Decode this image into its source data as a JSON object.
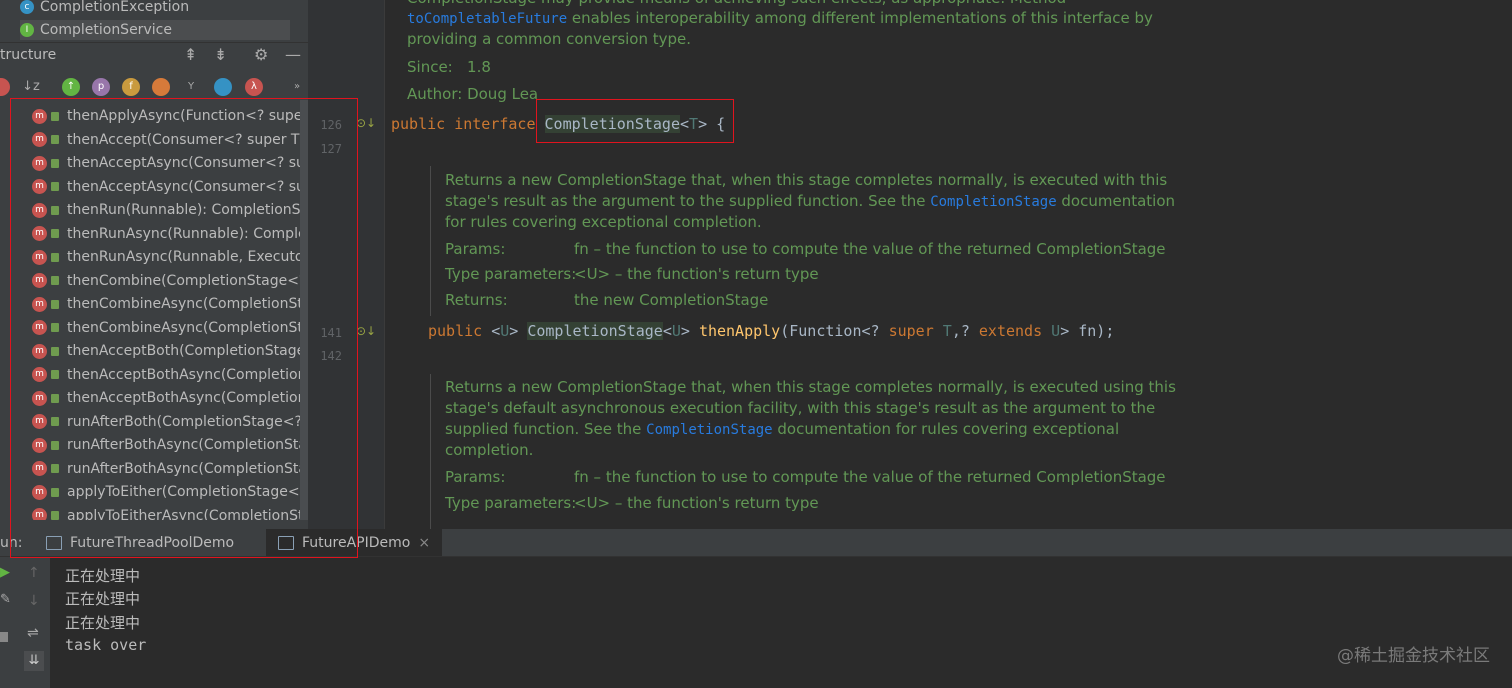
{
  "project_tree": [
    {
      "label": "CompletionException",
      "icon": "class-icon",
      "color": "#3592c4"
    },
    {
      "label": "CompletionService",
      "icon": "interface-icon",
      "color": "#62b543"
    }
  ],
  "structure": {
    "title": "tructure",
    "methods": [
      "thenApplyAsync(Function<? super",
      "thenAccept(Consumer<? super T>",
      "thenAcceptAsync(Consumer<? su",
      "thenAcceptAsync(Consumer<? su",
      "thenRun(Runnable): CompletionSt",
      "thenRunAsync(Runnable): Comple",
      "thenRunAsync(Runnable, Executor",
      "thenCombine(CompletionStage<?",
      "thenCombineAsync(CompletionSt",
      "thenCombineAsync(CompletionSt",
      "thenAcceptBoth(CompletionStage",
      "thenAcceptBothAsync(Completion",
      "thenAcceptBothAsync(Completion",
      "runAfterBoth(CompletionStage<?:",
      "runAfterBothAsync(CompletionSta",
      "runAfterBothAsync(CompletionSta",
      "applyToEither(CompletionStage<?",
      "applyToEitherAsync(CompletionSt"
    ]
  },
  "gutter": {
    "lines": [
      "126",
      "127",
      "141",
      "142"
    ]
  },
  "editor": {
    "doc_top_line0": "CompletionStage may provide means of achieving such effects, as appropriate. Method",
    "doc_top_link": "toCompletableFuture",
    "doc_top_line1_rest": " enables interoperability among different implementations of this interface by",
    "doc_top_line2": "providing a common conversion type.",
    "since_label": "Since:",
    "since_value": "1.8",
    "author_label": "Author:",
    "author_value": "Doug Lea",
    "decl": {
      "kw1": "public",
      "kw2": "interface",
      "type": "CompletionStage",
      "lt": "<",
      "tvar": "T",
      "gt": ">",
      "brace": "{"
    },
    "doc1": {
      "line1": "Returns a new CompletionStage that, when this stage completes normally, is executed with this",
      "line2_pre": "stage's result as the argument to the supplied function. See the ",
      "line2_link": "CompletionStage",
      "line2_post": " documentation",
      "line3": "for rules covering exceptional completion.",
      "params_label": "Params:",
      "params_value": "fn – the function to use to compute the value of the returned CompletionStage",
      "typeparams_label": "Type parameters:",
      "typeparams_value": "<U> – the function's return type",
      "returns_label": "Returns:",
      "returns_value": "the new CompletionStage"
    },
    "method1": {
      "kw1": "public",
      "tp1": "<",
      "tv1": "U",
      "tp2": ">",
      "type": "CompletionStage",
      "lt": "<",
      "tv2": "U",
      "gt": ">",
      "name": "thenApply",
      "args1": "(Function<? ",
      "kw_super": "super",
      "tv3": "T",
      "comma": ",? ",
      "kw_extends": "extends",
      "tv4": "U",
      "args2": "> fn);"
    },
    "doc2": {
      "line1": "Returns a new CompletionStage that, when this stage completes normally, is executed using this",
      "line2": "stage's default asynchronous execution facility, with this stage's result as the argument to the",
      "line3_pre": "supplied function. See the ",
      "line3_link": "CompletionStage",
      "line3_post": " documentation for rules covering exceptional",
      "line4": "completion.",
      "params_label": "Params:",
      "params_value": "fn – the function to use to compute the value of the returned CompletionStage",
      "typeparams_label": "Type parameters:",
      "typeparams_value": "<U> – the function's return type"
    }
  },
  "run": {
    "label": "un:",
    "tabs": [
      "FutureThreadPoolDemo",
      "FutureAPIDemo"
    ],
    "output": [
      "正在处理中",
      "正在处理中",
      "正在处理中",
      "task over"
    ]
  },
  "watermark": "@稀土掘金技术社区"
}
